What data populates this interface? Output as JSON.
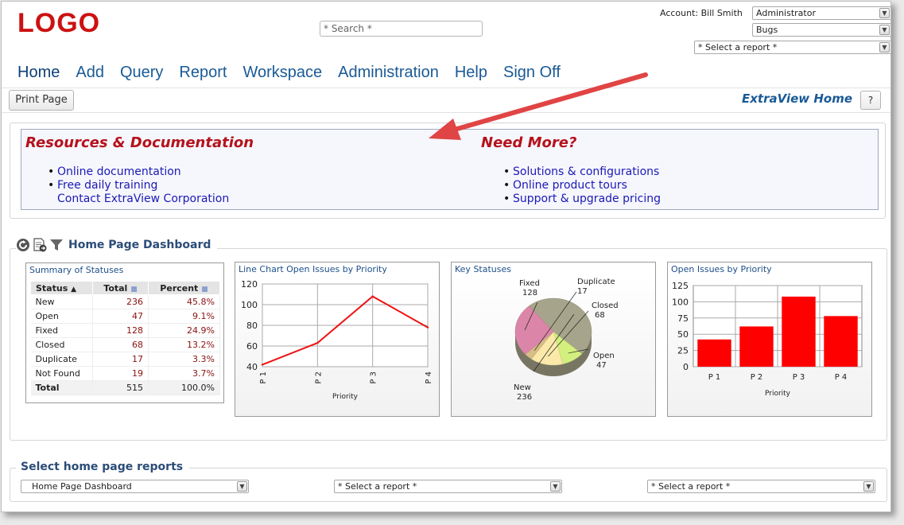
{
  "header": {
    "logo": "LOGO",
    "search_placeholder": "* Search *",
    "account_label": "Account: Bill Smith",
    "role_select": "Administrator",
    "area_select": "Bugs",
    "report_select": "* Select a report *"
  },
  "nav": [
    "Home",
    "Add",
    "Query",
    "Report",
    "Workspace",
    "Administration",
    "Help",
    "Sign Off"
  ],
  "toolbar": {
    "print_label": "Print Page",
    "page_title": "ExtraView Home",
    "help_label": "?"
  },
  "resources": {
    "left_title": "Resources & Documentation",
    "left_links": [
      "Online documentation",
      "Free daily training",
      "Contact ExtraView Corporation"
    ],
    "right_title": "Need More?",
    "right_links": [
      "Solutions & configurations",
      "Online product tours",
      "Support & upgrade pricing"
    ]
  },
  "dashboard": {
    "title": "Home Page Dashboard",
    "icons": [
      "refresh-icon",
      "export-icon",
      "filter-icon"
    ],
    "summary": {
      "title": "Summary of Statuses",
      "columns": [
        "Status",
        "Total",
        "Percent"
      ],
      "rows": [
        [
          "New",
          "236",
          "45.8%"
        ],
        [
          "Open",
          "47",
          "9.1%"
        ],
        [
          "Fixed",
          "128",
          "24.9%"
        ],
        [
          "Closed",
          "68",
          "13.2%"
        ],
        [
          "Duplicate",
          "17",
          "3.3%"
        ],
        [
          "Not Found",
          "19",
          "3.7%"
        ],
        [
          "Total",
          "515",
          "100.0%"
        ]
      ]
    }
  },
  "chart_data": [
    {
      "type": "line",
      "title": "Line Chart Open Issues by Priority",
      "categories": [
        "P 1",
        "P 2",
        "P 3",
        "P 4"
      ],
      "values": [
        42,
        63,
        108,
        78
      ],
      "xlabel": "Priority",
      "ylim": [
        40,
        120
      ],
      "yticks": [
        40,
        60,
        80,
        100,
        120
      ],
      "grid": true,
      "color": "#ee1111"
    },
    {
      "type": "pie",
      "title": "Key Statuses",
      "labels": [
        "New",
        "Open",
        "Closed",
        "Duplicate",
        "Fixed"
      ],
      "values": [
        236,
        47,
        68,
        17,
        128
      ],
      "colors": [
        "#a6a48a",
        "#d3ef7e",
        "#fbe9a9",
        "#d7bd86",
        "#db86a8"
      ]
    },
    {
      "type": "bar",
      "title": "Open Issues by Priority",
      "categories": [
        "P 1",
        "P 2",
        "P 3",
        "P 4"
      ],
      "values": [
        42,
        62,
        108,
        78
      ],
      "xlabel": "Priority",
      "ylim": [
        0,
        125
      ],
      "yticks": [
        0,
        25,
        50,
        75,
        100,
        125
      ],
      "grid": true,
      "color": "#ff0000"
    }
  ],
  "home_reports": {
    "title": "Select home page reports",
    "selects": [
      "Home Page Dashboard",
      "* Select a report *",
      "* Select a report *"
    ]
  }
}
